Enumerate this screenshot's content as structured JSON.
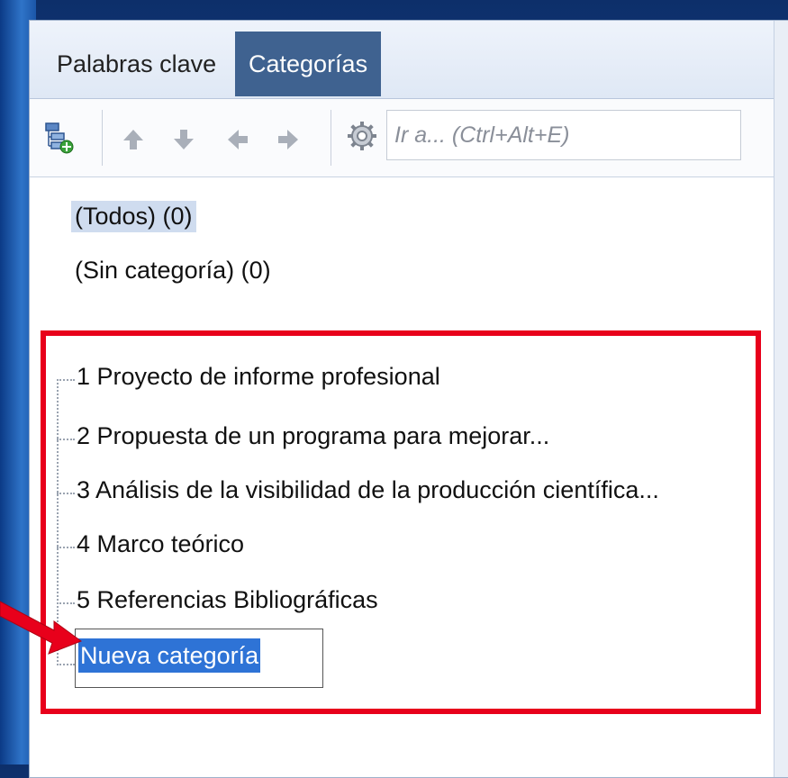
{
  "tabs": [
    {
      "label": "Palabras clave",
      "active": false
    },
    {
      "label": "Categorías",
      "active": true
    }
  ],
  "toolbar": {
    "search_placeholder": "Ir a... (Ctrl+Alt+E)",
    "icons": [
      "add-category-icon",
      "arrow-up-icon",
      "arrow-down-icon",
      "arrow-left-icon",
      "arrow-right-icon",
      "settings-icon"
    ]
  },
  "categories": {
    "all": "(Todos) (0)",
    "uncategorized": "(Sin categoría) (0)",
    "items": [
      "1 Proyecto de informe profesional",
      "2 Propuesta de un programa para mejorar...",
      "3 Análisis de la visibilidad de la producción científica...",
      "4 Marco teórico",
      "5 Referencias Bibliográficas"
    ],
    "new_item_value": "Nueva categoría"
  },
  "colors": {
    "accent_tab": "#3f6290",
    "highlight_box": "#e8001b",
    "text_selection": "#2e73d6",
    "selected_row": "#cfdcef"
  }
}
